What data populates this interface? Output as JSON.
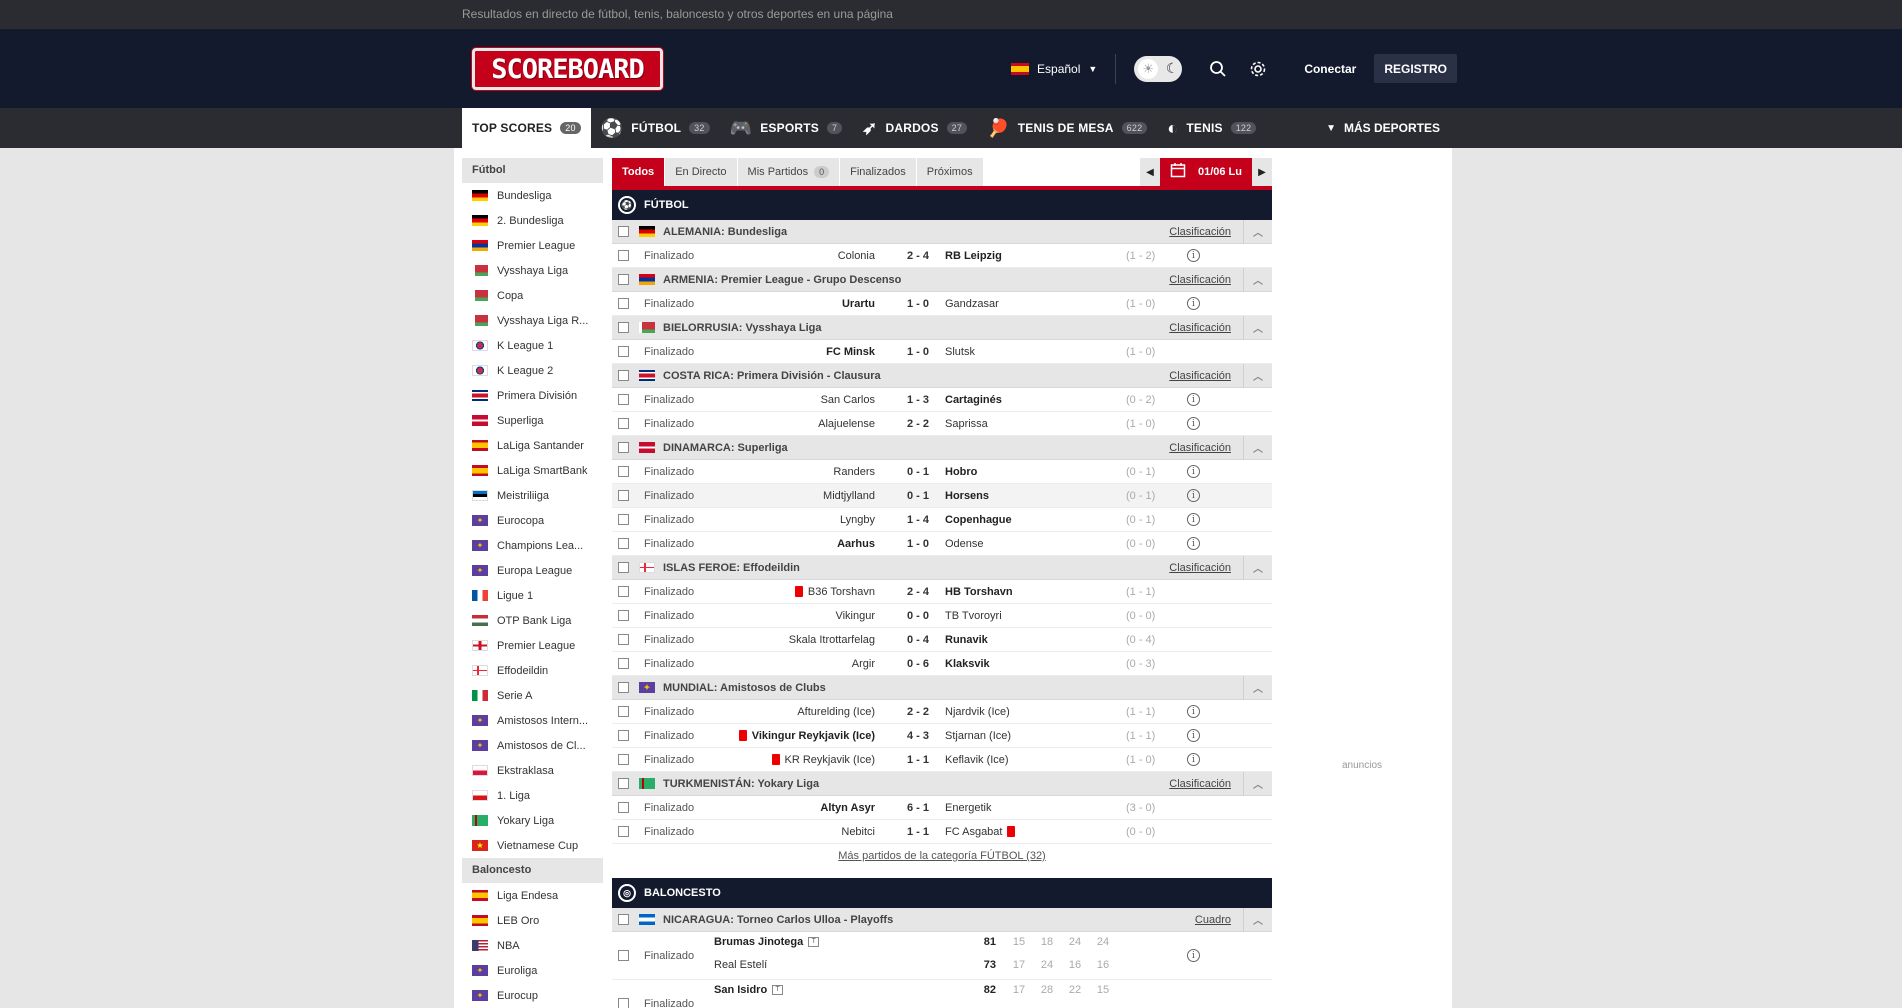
{
  "topbar": {
    "text": "Resultados en directo de fútbol, tenis, baloncesto y otros deportes en una página"
  },
  "header": {
    "logo": "SCOREBOARD",
    "language": "Español",
    "login": "Conectar",
    "register": "REGISTRO"
  },
  "nav": {
    "items": [
      {
        "label": "TOP SCORES",
        "count": "20",
        "icon": "none"
      },
      {
        "label": "FÚTBOL",
        "count": "32",
        "icon": "soccer-ball-icon"
      },
      {
        "label": "ESPORTS",
        "count": "7",
        "icon": "gamepad-icon"
      },
      {
        "label": "DARDOS",
        "count": "27",
        "icon": "dart-icon"
      },
      {
        "label": "TENIS DE MESA",
        "count": "622",
        "icon": "table-tennis-icon"
      },
      {
        "label": "TENIS",
        "count": "122",
        "icon": "tennis-ball-icon"
      }
    ],
    "more": "MÁS DEPORTES"
  },
  "sidebar": {
    "sections": [
      {
        "title": "Fútbol",
        "items": [
          {
            "label": "Bundesliga",
            "flag": "de"
          },
          {
            "label": "2. Bundesliga",
            "flag": "de"
          },
          {
            "label": "Premier League",
            "flag": "am"
          },
          {
            "label": "Vysshaya Liga",
            "flag": "by"
          },
          {
            "label": "Copa",
            "flag": "by"
          },
          {
            "label": "Vysshaya Liga R...",
            "flag": "by"
          },
          {
            "label": "K League 1",
            "flag": "kr"
          },
          {
            "label": "K League 2",
            "flag": "kr"
          },
          {
            "label": "Primera División",
            "flag": "cr"
          },
          {
            "label": "Superliga",
            "flag": "dk"
          },
          {
            "label": "LaLiga Santander",
            "flag": "es"
          },
          {
            "label": "LaLiga SmartBank",
            "flag": "es"
          },
          {
            "label": "Meistriliiga",
            "flag": "ee"
          },
          {
            "label": "Eurocopa",
            "flag": "eu"
          },
          {
            "label": "Champions Lea...",
            "flag": "eu"
          },
          {
            "label": "Europa League",
            "flag": "eu"
          },
          {
            "label": "Ligue 1",
            "flag": "fr"
          },
          {
            "label": "OTP Bank Liga",
            "flag": "hu"
          },
          {
            "label": "Premier League",
            "flag": "en"
          },
          {
            "label": "Effodeildin",
            "flag": "fo"
          },
          {
            "label": "Serie A",
            "flag": "it"
          },
          {
            "label": "Amistosos Intern...",
            "flag": "eu"
          },
          {
            "label": "Amistosos de Cl...",
            "flag": "eu"
          },
          {
            "label": "Ekstraklasa",
            "flag": "pl"
          },
          {
            "label": "1. Liga",
            "flag": "cz"
          },
          {
            "label": "Yokary Liga",
            "flag": "tm"
          },
          {
            "label": "Vietnamese Cup",
            "flag": "vn"
          }
        ]
      },
      {
        "title": "Baloncesto",
        "items": [
          {
            "label": "Liga Endesa",
            "flag": "es"
          },
          {
            "label": "LEB Oro",
            "flag": "es"
          },
          {
            "label": "NBA",
            "flag": "us"
          },
          {
            "label": "Euroliga",
            "flag": "eu"
          },
          {
            "label": "Eurocup",
            "flag": "eu"
          }
        ]
      }
    ]
  },
  "filters": {
    "tabs": [
      "Todos",
      "En Directo",
      "Mis Partidos",
      "Finalizados",
      "Próximos"
    ],
    "my_matches_count": "0",
    "date": "01/06 Lu"
  },
  "football": {
    "title": "FÚTBOL",
    "leagues": [
      {
        "name": "ALEMANIA: Bundesliga",
        "flag": "de",
        "link": "Clasificación",
        "matches": [
          {
            "status": "Finalizado",
            "home": "Colonia",
            "score": "2 - 4",
            "away": "RB Leipzig",
            "ht": "(1 - 2)",
            "winner": "away",
            "info": true
          }
        ]
      },
      {
        "name": "ARMENIA: Premier League - Grupo Descenso",
        "flag": "am",
        "link": "Clasificación",
        "matches": [
          {
            "status": "Finalizado",
            "home": "Urartu",
            "score": "1 - 0",
            "away": "Gandzasar",
            "ht": "(1 - 0)",
            "winner": "home",
            "info": true
          }
        ]
      },
      {
        "name": "BIELORRUSIA: Vysshaya Liga",
        "flag": "by",
        "link": "Clasificación",
        "matches": [
          {
            "status": "Finalizado",
            "home": "FC Minsk",
            "score": "1 - 0",
            "away": "Slutsk",
            "ht": "(1 - 0)",
            "winner": "home",
            "info": false
          }
        ]
      },
      {
        "name": "COSTA RICA: Primera División - Clausura",
        "flag": "cr",
        "link": "Clasificación",
        "matches": [
          {
            "status": "Finalizado",
            "home": "San Carlos",
            "score": "1 - 3",
            "away": "Cartaginés",
            "ht": "(0 - 2)",
            "winner": "away",
            "info": true
          },
          {
            "status": "Finalizado",
            "home": "Alajuelense",
            "score": "2 - 2",
            "away": "Saprissa",
            "ht": "(1 - 0)",
            "winner": "none",
            "info": true
          }
        ]
      },
      {
        "name": "DINAMARCA: Superliga",
        "flag": "dk",
        "link": "Clasificación",
        "matches": [
          {
            "status": "Finalizado",
            "home": "Randers",
            "score": "0 - 1",
            "away": "Hobro",
            "ht": "(0 - 1)",
            "winner": "away",
            "info": true
          },
          {
            "status": "Finalizado",
            "home": "Midtjylland",
            "score": "0 - 1",
            "away": "Horsens",
            "ht": "(0 - 1)",
            "winner": "away",
            "info": true,
            "alt": true
          },
          {
            "status": "Finalizado",
            "home": "Lyngby",
            "score": "1 - 4",
            "away": "Copenhague",
            "ht": "(0 - 1)",
            "winner": "away",
            "info": true
          },
          {
            "status": "Finalizado",
            "home": "Aarhus",
            "score": "1 - 0",
            "away": "Odense",
            "ht": "(0 - 0)",
            "winner": "home",
            "info": true
          }
        ]
      },
      {
        "name": "ISLAS FEROE: Effodeildin",
        "flag": "fo",
        "link": "Clasificación",
        "matches": [
          {
            "status": "Finalizado",
            "home": "B36 Torshavn",
            "score": "2 - 4",
            "away": "HB Torshavn",
            "ht": "(1 - 1)",
            "winner": "away",
            "info": false,
            "home_red": true
          },
          {
            "status": "Finalizado",
            "home": "Vikingur",
            "score": "0 - 0",
            "away": "TB Tvoroyri",
            "ht": "(0 - 0)",
            "winner": "none",
            "info": false
          },
          {
            "status": "Finalizado",
            "home": "Skala Itrottarfelag",
            "score": "0 - 4",
            "away": "Runavik",
            "ht": "(0 - 4)",
            "winner": "away",
            "info": false
          },
          {
            "status": "Finalizado",
            "home": "Argir",
            "score": "0 - 6",
            "away": "Klaksvik",
            "ht": "(0 - 3)",
            "winner": "away",
            "info": false
          }
        ]
      },
      {
        "name": "MUNDIAL: Amistosos de Clubs",
        "flag": "eu",
        "link": "",
        "matches": [
          {
            "status": "Finalizado",
            "home": "Afturelding (Ice)",
            "score": "2 - 2",
            "away": "Njardvik (Ice)",
            "ht": "(1 - 1)",
            "winner": "none",
            "info": true
          },
          {
            "status": "Finalizado",
            "home": "Vikingur Reykjavik (Ice)",
            "score": "4 - 3",
            "away": "Stjarnan (Ice)",
            "ht": "(1 - 1)",
            "winner": "home",
            "info": true,
            "home_red": true
          },
          {
            "status": "Finalizado",
            "home": "KR Reykjavik (Ice)",
            "score": "1 - 1",
            "away": "Keflavik (Ice)",
            "ht": "(1 - 0)",
            "winner": "none",
            "info": true,
            "home_red": true
          }
        ]
      },
      {
        "name": "TURKMENISTÁN: Yokary Liga",
        "flag": "tm",
        "link": "Clasificación",
        "matches": [
          {
            "status": "Finalizado",
            "home": "Altyn Asyr",
            "score": "6 - 1",
            "away": "Energetik",
            "ht": "(3 - 0)",
            "winner": "home",
            "info": false
          },
          {
            "status": "Finalizado",
            "home": "Nebitci",
            "score": "1 - 1",
            "away": "FC Asgabat",
            "ht": "(0 - 0)",
            "winner": "none",
            "info": false,
            "away_red": true
          }
        ]
      }
    ],
    "more": "Más partidos de la categoría FÚTBOL (32)"
  },
  "basketball": {
    "title": "BALONCESTO",
    "league": {
      "name": "NICARAGUA: Torneo Carlos Ulloa - Playoffs",
      "flag": "ni",
      "link": "Cuadro"
    },
    "matches": [
      {
        "status": "Finalizado",
        "t1": "Brumas Jinotega",
        "t2": "Real Estelí",
        "tot1": "81",
        "tot2": "73",
        "q1": [
          "15",
          "18",
          "24",
          "24"
        ],
        "q2": [
          "17",
          "24",
          "16",
          "16"
        ]
      },
      {
        "status": "Finalizado",
        "t1": "San Isidro",
        "t2": "",
        "tot1": "82",
        "tot2": "",
        "q1": [
          "17",
          "28",
          "22",
          "15"
        ],
        "q2": []
      }
    ]
  },
  "ads": "anuncios"
}
